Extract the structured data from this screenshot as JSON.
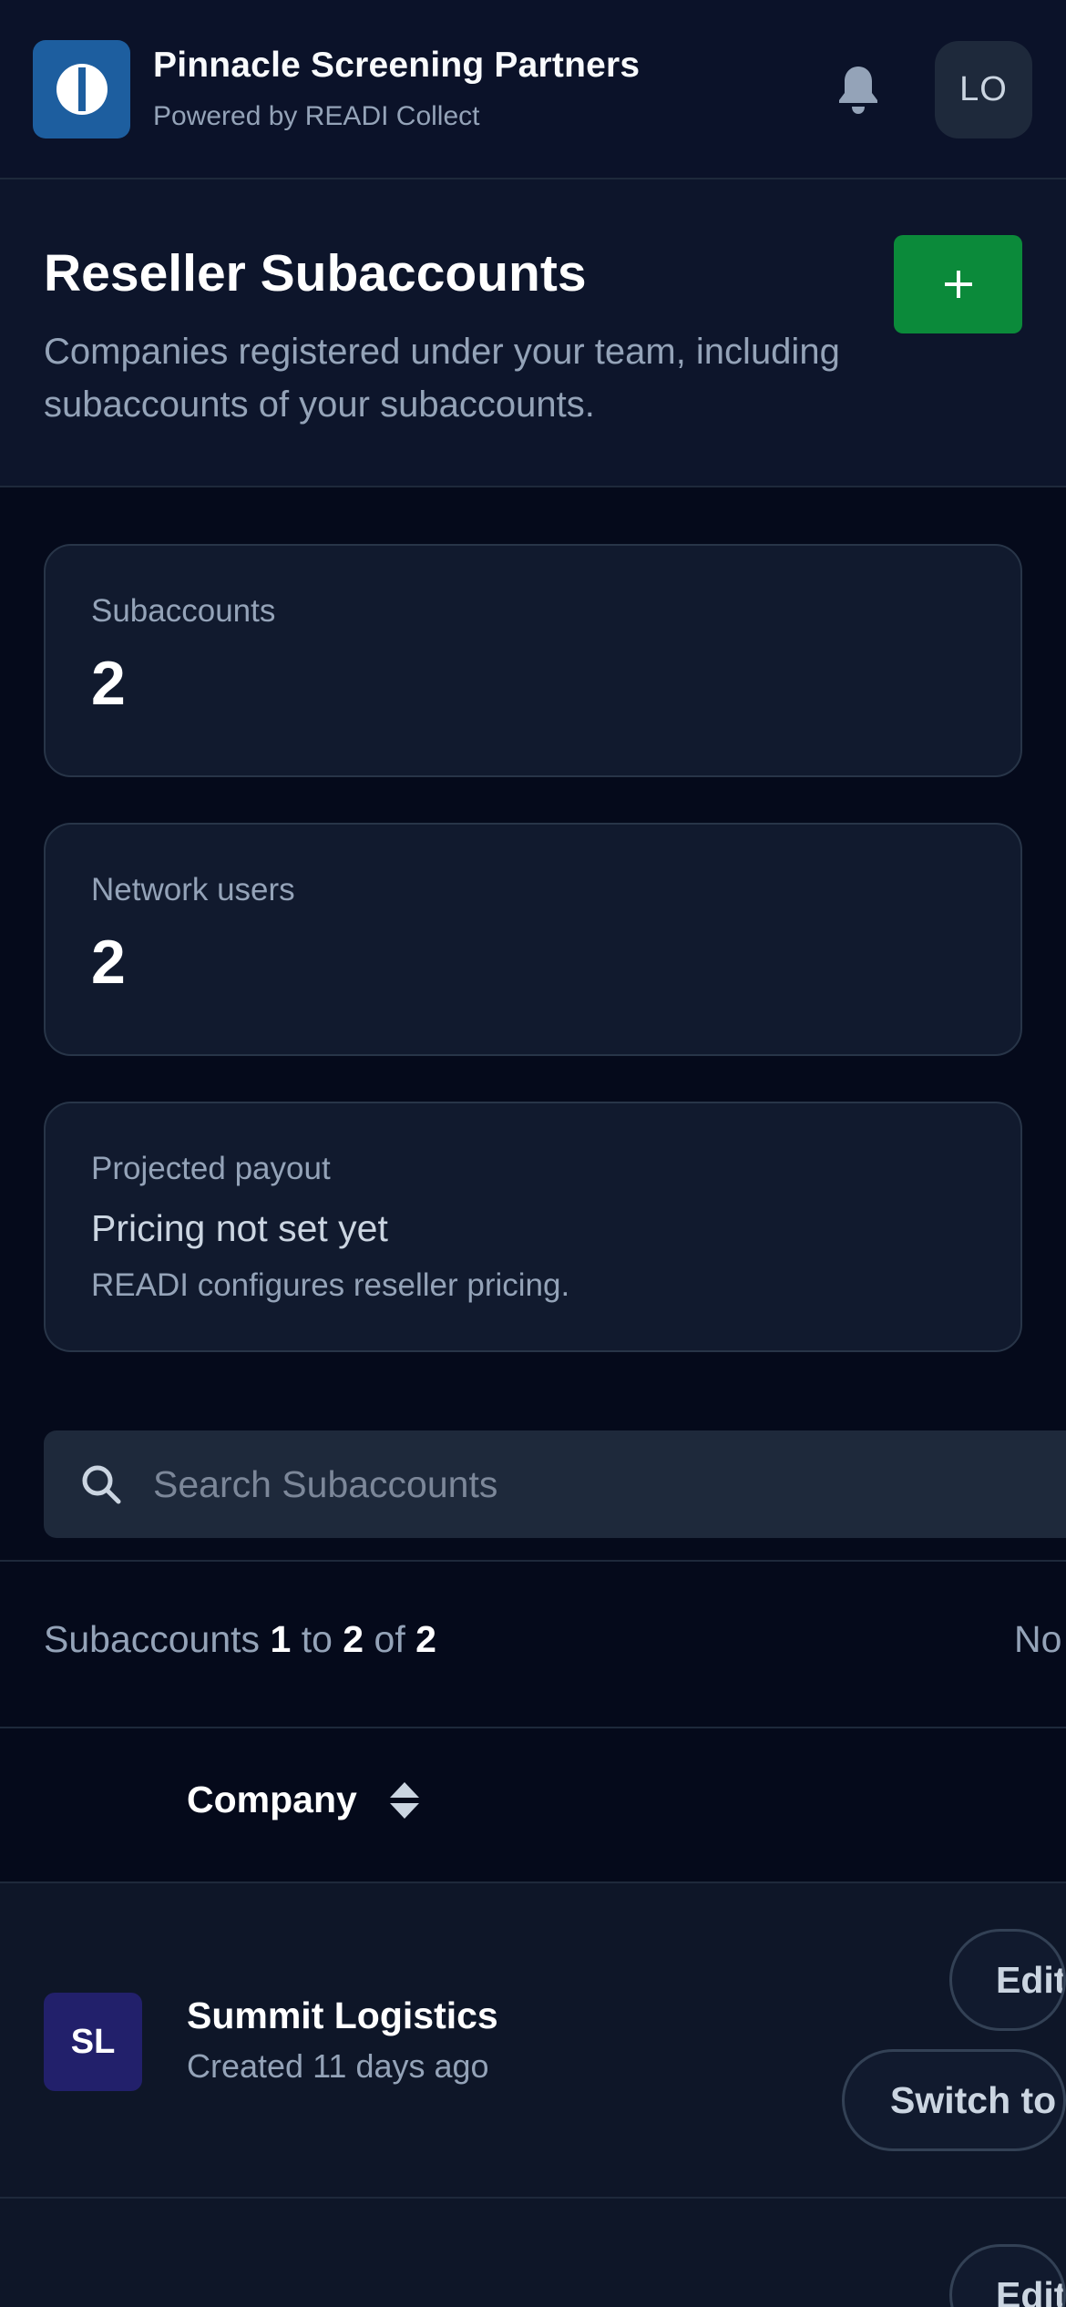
{
  "header": {
    "brand_name": "Pinnacle Screening Partners",
    "brand_sub": "Powered by READI Collect",
    "avatar_initials": "LO",
    "logo_icon": "brand-logo-icon",
    "notifications_icon": "bell-icon"
  },
  "page": {
    "title": "Reseller Subaccounts",
    "description": "Companies registered under your team, including subaccounts of your subaccounts.",
    "add_button_icon": "plus-icon"
  },
  "stats": {
    "subaccounts": {
      "label": "Subaccounts",
      "value": "2"
    },
    "network_users": {
      "label": "Network users",
      "value": "2"
    },
    "payout": {
      "label": "Projected payout",
      "value": "Pricing not set yet",
      "note": "READI configures reseller pricing."
    }
  },
  "search": {
    "placeholder": "Search Subaccounts",
    "value": ""
  },
  "pagination": {
    "prefix": "Subaccounts",
    "from": "1",
    "to_word": "to",
    "to": "2",
    "of_word": "of",
    "total": "2",
    "right_text": "No"
  },
  "table": {
    "columns": [
      {
        "label": "Company",
        "sort_icon": "sort-icon"
      }
    ],
    "rows": [
      {
        "initials": "SL",
        "name": "Summit Logistics",
        "created": "Created 11 days ago",
        "edit_label": "Edit",
        "switch_label": "Switch to"
      },
      {
        "edit_label": "Edit"
      }
    ]
  },
  "colors": {
    "background": "#050a1b",
    "header": "#0b1229",
    "card": "#111a2e",
    "accent_green": "#0b8a3a",
    "logo_blue": "#1d5e9f",
    "avatar_indigo": "#22206b"
  }
}
